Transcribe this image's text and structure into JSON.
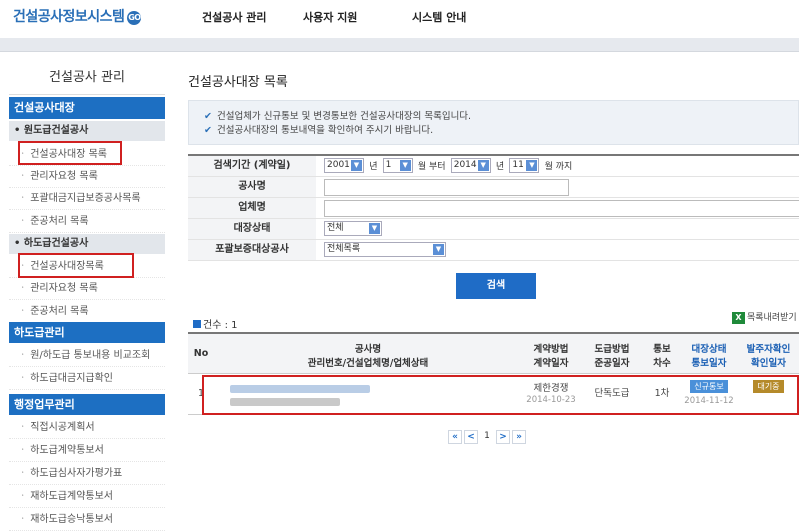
{
  "header": {
    "logo": "건설공사정보시스템",
    "logo_icon": "go-circle-icon",
    "nav": [
      "건설공사 관리",
      "사용자 지원",
      "시스템 안내"
    ]
  },
  "sidebar": {
    "title": "건설공사 관리",
    "items": [
      {
        "type": "head",
        "label": "건설공사대장"
      },
      {
        "type": "sub",
        "label": "• 원도급건설공사"
      },
      {
        "type": "link",
        "label": "건설공사대장 목록"
      },
      {
        "type": "link",
        "label": "관리자요청 목록"
      },
      {
        "type": "link",
        "label": "포괄대금지급보증공사목록"
      },
      {
        "type": "link",
        "label": "준공처리 목록"
      },
      {
        "type": "sub",
        "label": "• 하도급건설공사"
      },
      {
        "type": "link",
        "label": "건설공사대장목록"
      },
      {
        "type": "link",
        "label": "관리자요청 목록"
      },
      {
        "type": "link",
        "label": "준공처리 목록"
      },
      {
        "type": "head",
        "label": "하도급관리"
      },
      {
        "type": "link",
        "label": "원/하도급 통보내용 비교조회"
      },
      {
        "type": "link",
        "label": "하도급대금지급확인"
      },
      {
        "type": "head",
        "label": "행정업무관리"
      },
      {
        "type": "link",
        "label": "직접시공계획서"
      },
      {
        "type": "link",
        "label": "하도급계약통보서"
      },
      {
        "type": "link",
        "label": "하도급심사자가평가표"
      },
      {
        "type": "link",
        "label": "재하도급계약통보서"
      },
      {
        "type": "link",
        "label": "재하도급승낙통보서"
      }
    ]
  },
  "main": {
    "title": "건설공사대장 목록",
    "notices": [
      "건설업체가 신규통보 및 변경통보한 건설공사대장의 목록입니다.",
      "건설공사대장의 통보내역을 확인하여 주시기 바랍니다."
    ],
    "form": {
      "period_label": "검색기간 (계약일)",
      "start_year": "2001",
      "start_month": "1",
      "end_year": "2014",
      "end_month": "11",
      "year_unit": "년",
      "month_unit_from": "월 부터",
      "month_unit_to": "월 까지",
      "project_label": "공사명",
      "company_label": "업체명",
      "status_label": "대장상태",
      "status_value": "전체",
      "guarantee_label": "포괄보증대상공사",
      "guarantee_value": "전체목록"
    },
    "search_button": "검색",
    "count_label": "건수 : 1",
    "download_label": "목록내려받기",
    "download_icon": "excel-icon",
    "table": {
      "headers": {
        "no": "No",
        "project_line1": "공사명",
        "project_line2": "관리번호/건설업체명/업체상태",
        "contract_line1": "계약방법",
        "contract_line2": "계약일자",
        "sub_line1": "도급방법",
        "sub_line2": "준공일자",
        "notify_line1": "통보",
        "notify_line2": "차수",
        "status_line1": "대장상태",
        "status_line2": "통보일자",
        "confirm_line1": "발주자확인",
        "confirm_line2": "확인일자"
      },
      "rows": [
        {
          "no": "1",
          "contract_method": "제한경쟁",
          "contract_date": "2014-10-23",
          "sub_method": "단독도급",
          "notify_count": "1차",
          "status_badge": "신규통보",
          "notify_date": "2014-11-12",
          "confirm_badge": "대기중"
        }
      ]
    },
    "pager": {
      "first": "«",
      "prev": "<",
      "page": "1",
      "next": ">",
      "last": "»"
    }
  },
  "colors": {
    "brand": "#2a6fb7",
    "sidebar_head": "#1d6fc2",
    "highlight_box": "#d02020",
    "badge_new": "#4a90d9",
    "badge_wait": "#b58a2a"
  }
}
